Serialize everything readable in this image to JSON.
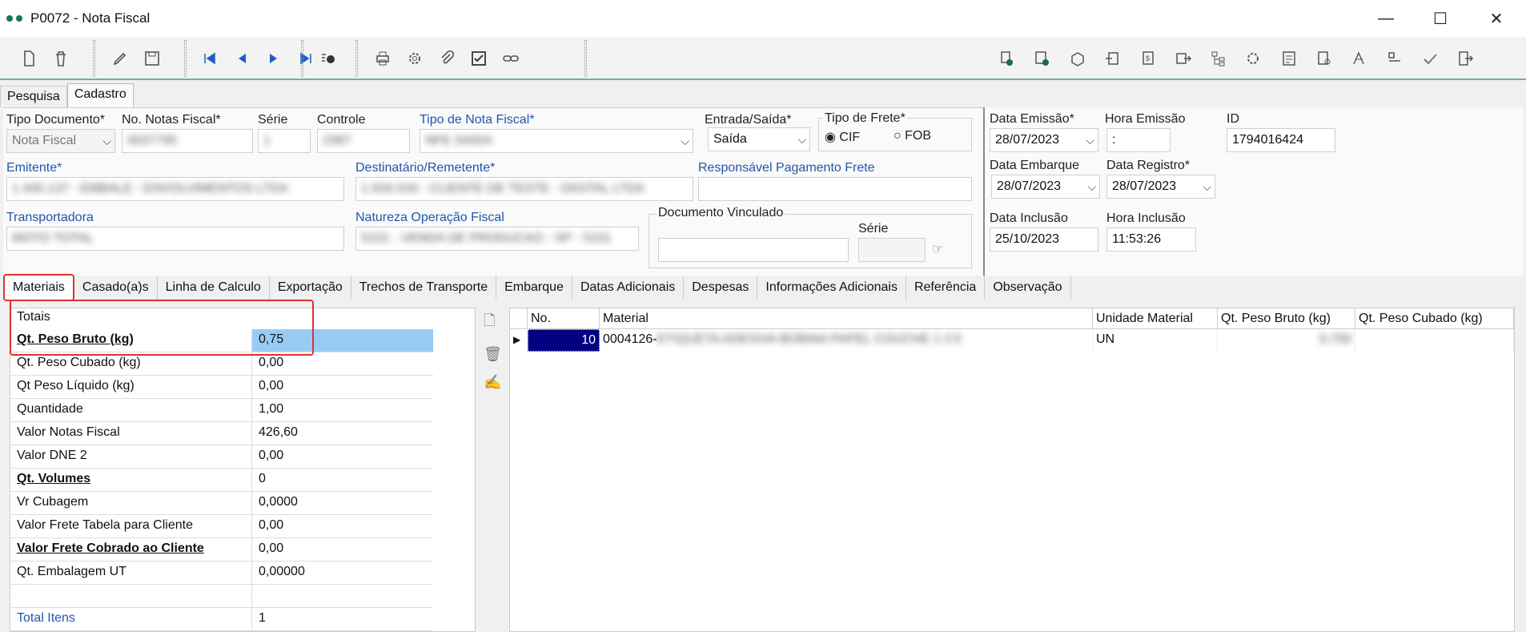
{
  "window": {
    "title": "P0072 - Nota Fiscal",
    "minimize": "—",
    "maximize": "☐",
    "close": "✕"
  },
  "page_tabs": [
    "Pesquisa",
    "Cadastro"
  ],
  "form": {
    "tipo_documento": {
      "label": "Tipo Documento*",
      "value": "Nota Fiscal"
    },
    "no_notas": {
      "label": "No. Notas Fiscal*",
      "value": "0037795"
    },
    "serie": {
      "label": "Série",
      "value": "1"
    },
    "controle": {
      "label": "Controle",
      "value": "2387"
    },
    "tipo_nota": {
      "label": "Tipo de Nota Fiscal*",
      "value": "NFE SAIDA"
    },
    "entrada_saida": {
      "label": "Entrada/Saída*",
      "value": "Saída"
    },
    "tipo_frete": {
      "label": "Tipo de Frete*",
      "opt1": "CIF",
      "opt2": "FOB"
    },
    "emitente": {
      "label": "Emitente*",
      "value": "1.445.137 - EMBALE - ENVOLVIMENTOS LTDA"
    },
    "destinatario": {
      "label": "Destinatário/Remetente*",
      "value": "1.934.534 - CLIENTE DE TESTE - DIGITAL LTDA"
    },
    "resp_frete": {
      "label": "Responsável Pagamento Frete",
      "value": ""
    },
    "transportadora": {
      "label": "Transportadora",
      "value": "MOTO TOTAL"
    },
    "natureza": {
      "label": "Natureza Operação Fiscal",
      "value": "5101 - VENDA DE PRODUCAO - SP - 5101"
    },
    "doc_vinculado": {
      "label": "Documento Vinculado",
      "serie_label": "Série"
    },
    "data_emissao": {
      "label": "Data Emissão*",
      "value": "28/07/2023"
    },
    "hora_emissao": {
      "label": "Hora Emissão",
      "value": ":"
    },
    "id": {
      "label": "ID",
      "value": "1794016424"
    },
    "data_embarque": {
      "label": "Data Embarque",
      "value": "28/07/2023"
    },
    "data_registro": {
      "label": "Data Registro*",
      "value": "28/07/2023"
    },
    "data_inclusao": {
      "label": "Data Inclusão",
      "value": "25/10/2023"
    },
    "hora_inclusao": {
      "label": "Hora Inclusão",
      "value": "11:53:26"
    }
  },
  "tabs": [
    "Materiais",
    "Casado(a)s",
    "Linha de Calculo",
    "Exportação",
    "Trechos de Transporte",
    "Embarque",
    "Datas Adicionais",
    "Despesas",
    "Informações Adicionais",
    "Referência",
    "Observação"
  ],
  "totals": {
    "caption": "Totais",
    "rows": [
      {
        "k": "Qt. Peso Bruto (kg)",
        "v": "0,75"
      },
      {
        "k": "Qt. Peso Cubado (kg)",
        "v": "0,00"
      },
      {
        "k": "Qt Peso Líquido (kg)",
        "v": "0,00"
      },
      {
        "k": "Quantidade",
        "v": "1,00"
      },
      {
        "k": "Valor Notas Fiscal",
        "v": "426,60"
      },
      {
        "k": "Valor DNE 2",
        "v": "0,00"
      },
      {
        "k": "Qt. Volumes",
        "v": "0"
      },
      {
        "k": "Vr Cubagem",
        "v": "0,0000"
      },
      {
        "k": "Valor Frete Tabela para Cliente",
        "v": "0,00"
      },
      {
        "k": "Valor Frete Cobrado ao Cliente",
        "v": "0,00"
      },
      {
        "k": "Qt. Embalagem UT",
        "v": "0,00000"
      },
      {
        "k": "",
        "v": ""
      },
      {
        "k": "Total Itens",
        "v": "1"
      }
    ]
  },
  "grid": {
    "headers": [
      "No.",
      "Material",
      "Unidade Material",
      "Qt. Peso Bruto (kg)",
      "Qt. Peso Cubado (kg)"
    ],
    "rows": [
      {
        "no": "10",
        "material": "0004126-",
        "material_blur": "ETIQUETA ADESIVA BOBINA PAPEL COUCHE 1 CX",
        "unidade": "UN",
        "peso_bruto": "0,750",
        "peso_cubado": ""
      }
    ]
  },
  "colors": {
    "accent": "#0f7a5c",
    "highlight_red": "#e03030",
    "selection": "#000080",
    "label_blue": "#2255aa"
  }
}
